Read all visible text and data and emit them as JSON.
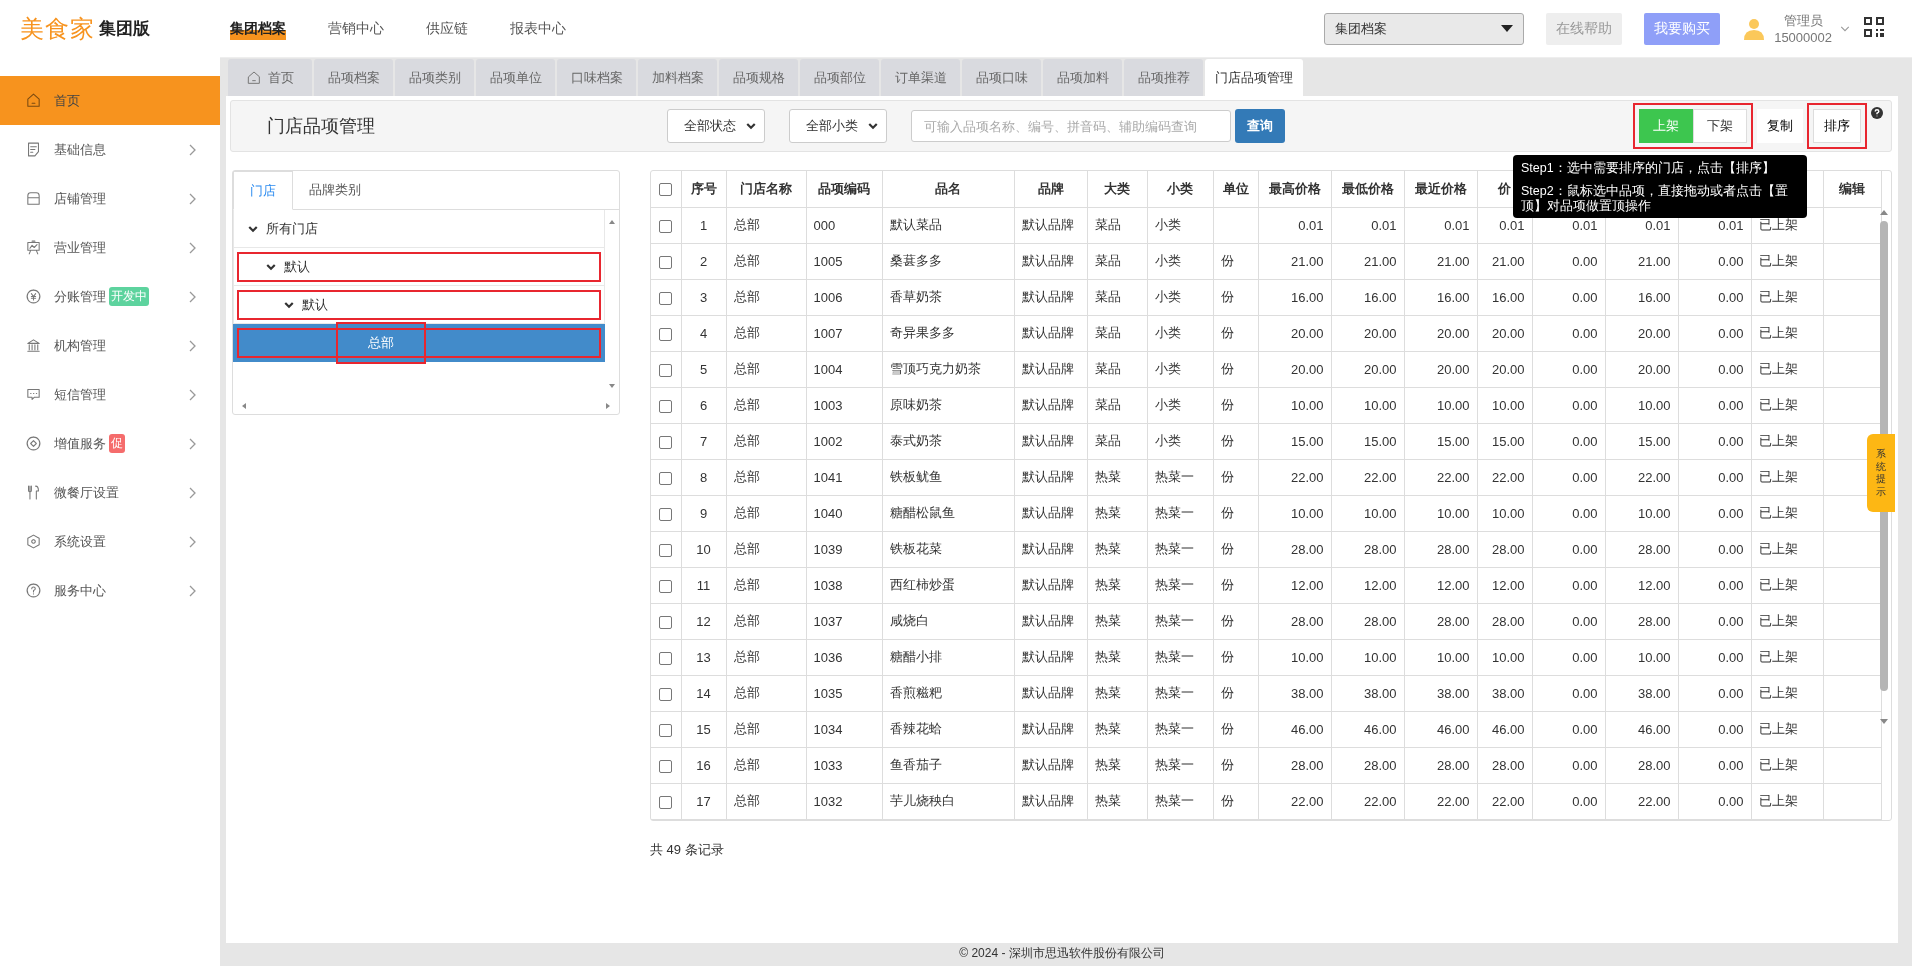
{
  "topbar": {
    "logo": "美食家",
    "edition": "集团版",
    "nav": [
      {
        "label": "集团档案",
        "selected": true
      },
      {
        "label": "营销中心",
        "selected": false
      },
      {
        "label": "供应链",
        "selected": false
      },
      {
        "label": "报表中心",
        "selected": false
      }
    ],
    "scope_select": "集团档案",
    "help_button": "在线帮助",
    "buy_button": "我要购买",
    "user": {
      "role": "管理员",
      "account": "15000002"
    }
  },
  "sidebar": {
    "items": [
      {
        "label": "首页",
        "selected": true,
        "expandable": false
      },
      {
        "label": "基础信息",
        "selected": false,
        "expandable": true
      },
      {
        "label": "店铺管理",
        "selected": false,
        "expandable": true
      },
      {
        "label": "营业管理",
        "selected": false,
        "expandable": true
      },
      {
        "label": "分账管理",
        "selected": false,
        "expandable": true,
        "badge": {
          "text": "开发中",
          "color": "#5dd39e"
        }
      },
      {
        "label": "机构管理",
        "selected": false,
        "expandable": true
      },
      {
        "label": "短信管理",
        "selected": false,
        "expandable": true
      },
      {
        "label": "增值服务",
        "selected": false,
        "expandable": true,
        "badge": {
          "text": "促",
          "color": "#f56c6c"
        }
      },
      {
        "label": "微餐厅设置",
        "selected": false,
        "expandable": true
      },
      {
        "label": "系统设置",
        "selected": false,
        "expandable": true
      },
      {
        "label": "服务中心",
        "selected": false,
        "expandable": true
      }
    ]
  },
  "tabs": [
    {
      "label": "首页",
      "selected": false
    },
    {
      "label": "品项档案",
      "selected": false
    },
    {
      "label": "品项类别",
      "selected": false
    },
    {
      "label": "品项单位",
      "selected": false
    },
    {
      "label": "口味档案",
      "selected": false
    },
    {
      "label": "加料档案",
      "selected": false
    },
    {
      "label": "品项规格",
      "selected": false
    },
    {
      "label": "品项部位",
      "selected": false
    },
    {
      "label": "订单渠道",
      "selected": false
    },
    {
      "label": "品项口味",
      "selected": false
    },
    {
      "label": "品项加料",
      "selected": false
    },
    {
      "label": "品项推荐",
      "selected": false
    },
    {
      "label": "门店品项管理",
      "selected": true
    }
  ],
  "toolbar": {
    "title": "门店品项管理",
    "filters": [
      "全部状态",
      "全部小类"
    ],
    "search": {
      "placeholder": "可输入品项名称、编号、拼音码、辅助编码查询"
    },
    "search_button": "查询",
    "status_toggle": {
      "highlighted": true,
      "options": [
        {
          "label": "上架",
          "selected": true
        },
        {
          "label": "下架",
          "selected": false
        }
      ]
    },
    "copy_button": "复制",
    "sort_button": {
      "label": "排序",
      "highlighted": true
    }
  },
  "store_panel": {
    "tabs": [
      {
        "label": "门店",
        "selected": true
      },
      {
        "label": "品牌类别",
        "selected": false
      }
    ],
    "tree": [
      {
        "label": "所有门店",
        "expanded": true,
        "selected": false,
        "highlighted": false,
        "children": [
          {
            "label": "默认",
            "expanded": true,
            "selected": false,
            "highlighted": true,
            "children": [
              {
                "label": "默认",
                "expanded": true,
                "selected": false,
                "highlighted": true,
                "children": [
                  {
                    "label": "总部",
                    "selected": true,
                    "highlighted": true
                  }
                ]
              }
            ]
          }
        ]
      }
    ]
  },
  "tooltip": {
    "lines": [
      "Step1：选中需要排序的门店，点击【排序】",
      "Step2：鼠标选中品项，直接拖动或者点击【置顶】对品项做置顶操作"
    ]
  },
  "table": {
    "header_checked": false,
    "columns": [
      {
        "label": "序号"
      },
      {
        "label": "门店名称"
      },
      {
        "label": "品项编码"
      },
      {
        "label": "品名"
      },
      {
        "label": "品牌"
      },
      {
        "label": "大类"
      },
      {
        "label": "小类"
      },
      {
        "label": "单位"
      },
      {
        "label": "最高价格"
      },
      {
        "label": "最低价格"
      },
      {
        "label": "最近价格"
      },
      {
        "label": "价"
      },
      {},
      {},
      {},
      {},
      {
        "label": "编辑"
      }
    ],
    "rows": [
      {
        "checked": false,
        "cells": [
          "1",
          "总部",
          "000",
          "默认菜品",
          "默认品牌",
          "菜品",
          "小类",
          "",
          "0.01",
          "0.01",
          "0.01",
          "0.01",
          "0.01",
          "0.01",
          "0.01",
          "已上架"
        ]
      },
      {
        "checked": false,
        "cells": [
          "2",
          "总部",
          "1005",
          "桑葚多多",
          "默认品牌",
          "菜品",
          "小类",
          "份",
          "21.00",
          "21.00",
          "21.00",
          "21.00",
          "0.00",
          "21.00",
          "0.00",
          "已上架"
        ]
      },
      {
        "checked": false,
        "cells": [
          "3",
          "总部",
          "1006",
          "香草奶茶",
          "默认品牌",
          "菜品",
          "小类",
          "份",
          "16.00",
          "16.00",
          "16.00",
          "16.00",
          "0.00",
          "16.00",
          "0.00",
          "已上架"
        ]
      },
      {
        "checked": false,
        "cells": [
          "4",
          "总部",
          "1007",
          "奇异果多多",
          "默认品牌",
          "菜品",
          "小类",
          "份",
          "20.00",
          "20.00",
          "20.00",
          "20.00",
          "0.00",
          "20.00",
          "0.00",
          "已上架"
        ]
      },
      {
        "checked": false,
        "cells": [
          "5",
          "总部",
          "1004",
          "雪顶巧克力奶茶",
          "默认品牌",
          "菜品",
          "小类",
          "份",
          "20.00",
          "20.00",
          "20.00",
          "20.00",
          "0.00",
          "20.00",
          "0.00",
          "已上架"
        ]
      },
      {
        "checked": false,
        "cells": [
          "6",
          "总部",
          "1003",
          "原味奶茶",
          "默认品牌",
          "菜品",
          "小类",
          "份",
          "10.00",
          "10.00",
          "10.00",
          "10.00",
          "0.00",
          "10.00",
          "0.00",
          "已上架"
        ]
      },
      {
        "checked": false,
        "cells": [
          "7",
          "总部",
          "1002",
          "泰式奶茶",
          "默认品牌",
          "菜品",
          "小类",
          "份",
          "15.00",
          "15.00",
          "15.00",
          "15.00",
          "0.00",
          "15.00",
          "0.00",
          "已上架"
        ]
      },
      {
        "checked": false,
        "cells": [
          "8",
          "总部",
          "1041",
          "铁板鱿鱼",
          "默认品牌",
          "热菜",
          "热菜一",
          "份",
          "22.00",
          "22.00",
          "22.00",
          "22.00",
          "0.00",
          "22.00",
          "0.00",
          "已上架"
        ]
      },
      {
        "checked": false,
        "cells": [
          "9",
          "总部",
          "1040",
          "糖醋松鼠鱼",
          "默认品牌",
          "热菜",
          "热菜一",
          "份",
          "10.00",
          "10.00",
          "10.00",
          "10.00",
          "0.00",
          "10.00",
          "0.00",
          "已上架"
        ]
      },
      {
        "checked": false,
        "cells": [
          "10",
          "总部",
          "1039",
          "铁板花菜",
          "默认品牌",
          "热菜",
          "热菜一",
          "份",
          "28.00",
          "28.00",
          "28.00",
          "28.00",
          "0.00",
          "28.00",
          "0.00",
          "已上架"
        ]
      },
      {
        "checked": false,
        "cells": [
          "11",
          "总部",
          "1038",
          "西红柿炒蛋",
          "默认品牌",
          "热菜",
          "热菜一",
          "份",
          "12.00",
          "12.00",
          "12.00",
          "12.00",
          "0.00",
          "12.00",
          "0.00",
          "已上架"
        ]
      },
      {
        "checked": false,
        "cells": [
          "12",
          "总部",
          "1037",
          "咸烧白",
          "默认品牌",
          "热菜",
          "热菜一",
          "份",
          "28.00",
          "28.00",
          "28.00",
          "28.00",
          "0.00",
          "28.00",
          "0.00",
          "已上架"
        ]
      },
      {
        "checked": false,
        "cells": [
          "13",
          "总部",
          "1036",
          "糖醋小排",
          "默认品牌",
          "热菜",
          "热菜一",
          "份",
          "10.00",
          "10.00",
          "10.00",
          "10.00",
          "0.00",
          "10.00",
          "0.00",
          "已上架"
        ]
      },
      {
        "checked": false,
        "cells": [
          "14",
          "总部",
          "1035",
          "香煎糍粑",
          "默认品牌",
          "热菜",
          "热菜一",
          "份",
          "38.00",
          "38.00",
          "38.00",
          "38.00",
          "0.00",
          "38.00",
          "0.00",
          "已上架"
        ]
      },
      {
        "checked": false,
        "cells": [
          "15",
          "总部",
          "1034",
          "香辣花蛤",
          "默认品牌",
          "热菜",
          "热菜一",
          "份",
          "46.00",
          "46.00",
          "46.00",
          "46.00",
          "0.00",
          "46.00",
          "0.00",
          "已上架"
        ]
      },
      {
        "checked": false,
        "cells": [
          "16",
          "总部",
          "1033",
          "鱼香茄子",
          "默认品牌",
          "热菜",
          "热菜一",
          "份",
          "28.00",
          "28.00",
          "28.00",
          "28.00",
          "0.00",
          "28.00",
          "0.00",
          "已上架"
        ]
      },
      {
        "checked": false,
        "cells": [
          "17",
          "总部",
          "1032",
          "芋儿烧秧白",
          "默认品牌",
          "热菜",
          "热菜一",
          "份",
          "22.00",
          "22.00",
          "22.00",
          "22.00",
          "0.00",
          "22.00",
          "0.00",
          "已上架"
        ]
      }
    ]
  },
  "record_count": "共 49 条记录",
  "side_tab": "系统提示",
  "footer": "© 2024 - 深圳市思迅软件股份有限公司"
}
